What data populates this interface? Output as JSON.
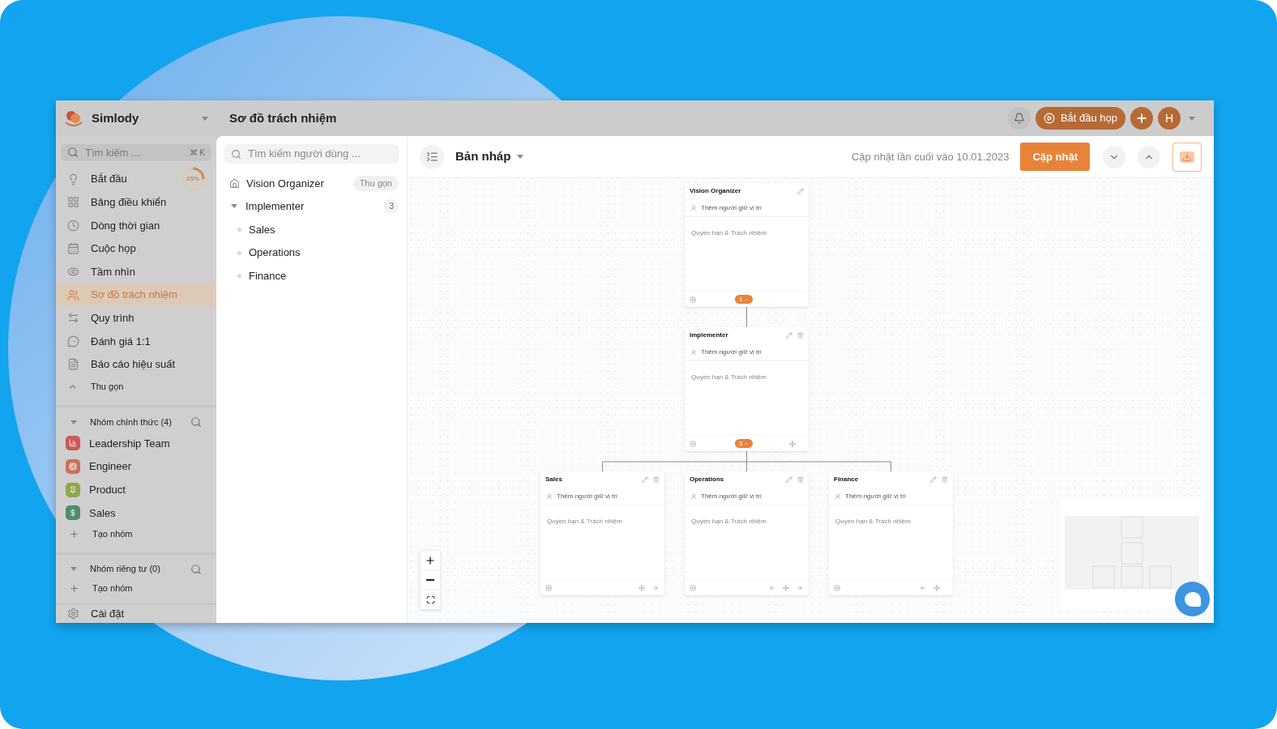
{
  "app": {
    "name": "Simlody",
    "page_title": "Sơ đồ trách nhiệm"
  },
  "header": {
    "start_meeting": "Bắt đầu họp",
    "avatar": "H"
  },
  "sidebar": {
    "search": {
      "placeholder": "Tìm kiếm ...",
      "shortcut": "⌘ K"
    },
    "items": [
      {
        "label": "Bắt đầu",
        "selected": false,
        "progress": {
          "reading": "25%",
          "level": 0.25
        }
      },
      {
        "label": "Bảng điều khiển",
        "selected": false
      },
      {
        "label": "Dòng thời gian",
        "selected": false
      },
      {
        "label": "Cuộc họp",
        "selected": false
      },
      {
        "label": "Tầm nhìn",
        "selected": false
      },
      {
        "label": "Sơ đồ trách nhiệm",
        "selected": true
      },
      {
        "label": "Quy trình",
        "selected": false
      },
      {
        "label": "Đánh giá 1:1",
        "selected": false
      },
      {
        "label": "Báo cáo hiệu suất",
        "selected": false
      }
    ],
    "collapse": "Thu gọn",
    "sections": [
      {
        "title": "Nhóm chính thức (4)",
        "expanded": true,
        "groups": [
          {
            "name": "Leadership Team",
            "color": "#c95a57"
          },
          {
            "name": "Engineer",
            "color": "#c7735a"
          },
          {
            "name": "Product",
            "color": "#8ea84c"
          },
          {
            "name": "Sales",
            "color": "#4e8c6b"
          }
        ],
        "create": "Tạo nhóm"
      },
      {
        "title": "Nhóm riêng tư (0)",
        "expanded": true,
        "create": "Tạo nhóm"
      }
    ],
    "settings": "Cài đặt"
  },
  "tree": {
    "search": {
      "placeholder": "Tìm kiếm người dùng ..."
    },
    "items": [
      {
        "kind": "root",
        "label": "Vision Organizer",
        "badge": "Thu gọn"
      },
      {
        "kind": "group",
        "label": "Implementer",
        "count": "3",
        "expanded": true,
        "children": [
          {
            "label": "Sales"
          },
          {
            "label": "Operations"
          },
          {
            "label": "Finance"
          }
        ]
      }
    ]
  },
  "toolbar": {
    "version": "Bản nháp",
    "last_updated": "Cập nhật lần cuối vào 10.01.2023",
    "update_button": "Cập nhật"
  },
  "chart": {
    "root": {
      "title": "Vision Organizer",
      "holder": "Thêm người giữ vị trí",
      "description": "Quyền hạn & Trách nhiệm",
      "deletable": false,
      "movable": false,
      "move_left": false,
      "move_right": false,
      "children_count": "1",
      "expanded": true,
      "children": [
        {
          "title": "Implementer",
          "holder": "Thêm người giữ vị trí",
          "description": "Quyền hạn & Trách nhiệm",
          "deletable": true,
          "movable": true,
          "move_left": false,
          "move_right": false,
          "children_count": "3",
          "expanded": true,
          "children": [
            {
              "title": "Sales",
              "holder": "Thêm người giữ vị trí",
              "description": "Quyền hạn & Trách nhiệm",
              "deletable": true,
              "movable": true,
              "move_left": false,
              "move_right": true
            },
            {
              "title": "Operations",
              "holder": "Thêm người giữ vị trí",
              "description": "Quyền hạn & Trách nhiệm",
              "deletable": true,
              "movable": true,
              "move_left": true,
              "move_right": true
            },
            {
              "title": "Finance",
              "holder": "Thêm người giữ vị trí",
              "description": "Quyền hạn & Trách nhiệm",
              "deletable": true,
              "movable": true,
              "move_left": true,
              "move_right": false
            }
          ]
        }
      ]
    }
  }
}
